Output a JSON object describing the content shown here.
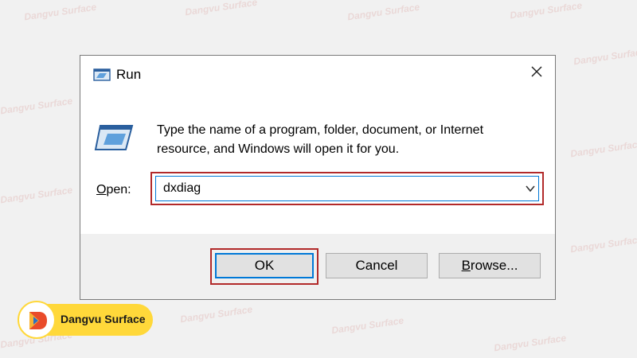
{
  "watermark": "Dangvu Surface",
  "dialog": {
    "title": "Run",
    "description": "Type the name of a program, folder, document, or Internet resource, and Windows will open it for you.",
    "open_label_accel": "O",
    "open_label_rest": "pen:",
    "input_value": "dxdiag",
    "buttons": {
      "ok": "OK",
      "cancel": "Cancel",
      "browse_accel": "B",
      "browse_rest": "rowse..."
    }
  },
  "logo": {
    "text": "Dangvu Surface"
  },
  "colors": {
    "highlight": "#b22a2a",
    "focus": "#0078d7",
    "logo_bg": "#ffd83a"
  }
}
